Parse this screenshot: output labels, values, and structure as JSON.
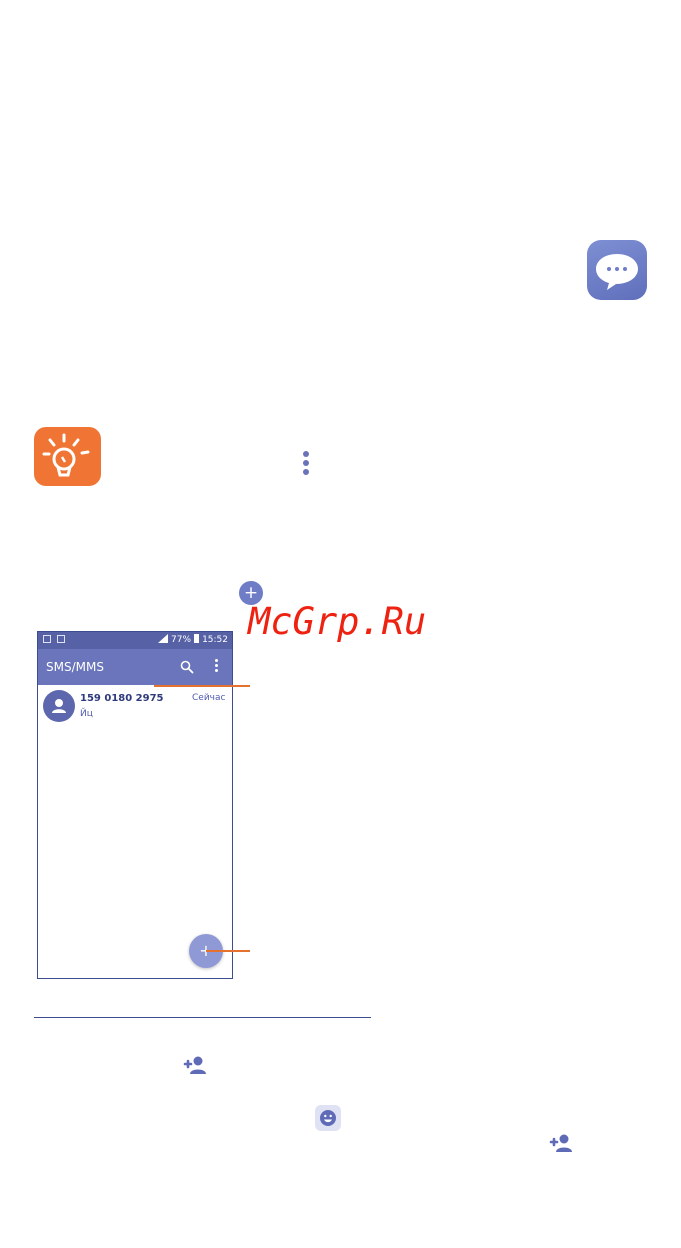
{
  "watermark": "McGrp.Ru",
  "icons": {
    "app_icon": "messaging-app-icon",
    "tip_icon": "lightbulb-tip-icon",
    "more_icon": "more-vertical-icon",
    "new_message_icon": "plus-circle-icon",
    "add_contact_icon": "add-person-icon",
    "emoji_icon": "emoji-icon"
  },
  "phone": {
    "status": {
      "battery": "77%",
      "time": "15:52"
    },
    "app_bar": {
      "title": "SMS/MMS"
    },
    "conversations": [
      {
        "name": "159 0180 2975",
        "time": "Сейчас",
        "snippet": "Йц"
      }
    ],
    "fab_label": "+"
  },
  "inline_plus_label": "+",
  "colors": {
    "accent": "#6a75bb",
    "status_bar": "#5762a6",
    "tip_orange": "#f07534",
    "callout": "#e4712f"
  }
}
